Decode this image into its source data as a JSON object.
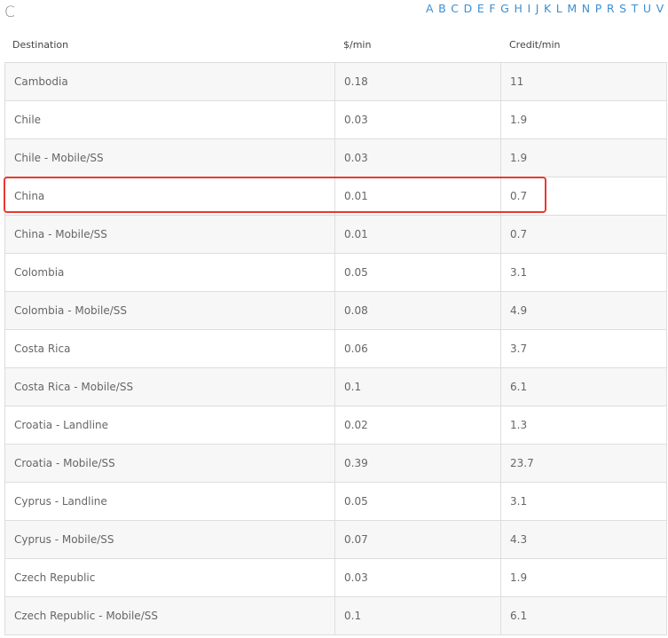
{
  "section": {
    "letter": "C"
  },
  "alpha_nav": [
    "A",
    "B",
    "C",
    "D",
    "E",
    "F",
    "G",
    "H",
    "I",
    "J",
    "K",
    "L",
    "M",
    "N",
    "P",
    "R",
    "S",
    "T",
    "U",
    "V"
  ],
  "columns": {
    "destination": "Destination",
    "rate": "$/min",
    "credit": "Credit/min"
  },
  "rows": [
    {
      "destination": "Cambodia",
      "rate": "0.18",
      "credit": "11"
    },
    {
      "destination": "Chile",
      "rate": "0.03",
      "credit": "1.9"
    },
    {
      "destination": "Chile - Mobile/SS",
      "rate": "0.03",
      "credit": "1.9"
    },
    {
      "destination": "China",
      "rate": "0.01",
      "credit": "0.7"
    },
    {
      "destination": "China - Mobile/SS",
      "rate": "0.01",
      "credit": "0.7"
    },
    {
      "destination": "Colombia",
      "rate": "0.05",
      "credit": "3.1"
    },
    {
      "destination": "Colombia - Mobile/SS",
      "rate": "0.08",
      "credit": "4.9"
    },
    {
      "destination": "Costa Rica",
      "rate": "0.06",
      "credit": "3.7"
    },
    {
      "destination": "Costa Rica - Mobile/SS",
      "rate": "0.1",
      "credit": "6.1"
    },
    {
      "destination": "Croatia - Landline",
      "rate": "0.02",
      "credit": "1.3"
    },
    {
      "destination": "Croatia - Mobile/SS",
      "rate": "0.39",
      "credit": "23.7"
    },
    {
      "destination": "Cyprus - Landline",
      "rate": "0.05",
      "credit": "3.1"
    },
    {
      "destination": "Cyprus - Mobile/SS",
      "rate": "0.07",
      "credit": "4.3"
    },
    {
      "destination": "Czech Republic",
      "rate": "0.03",
      "credit": "1.9"
    },
    {
      "destination": "Czech Republic - Mobile/SS",
      "rate": "0.1",
      "credit": "6.1"
    }
  ],
  "highlighted_row": "China",
  "colors": {
    "link": "#3d8fd1",
    "highlight_border": "#e8392f",
    "stripe": "#f7f7f7",
    "border": "#dddddd"
  }
}
